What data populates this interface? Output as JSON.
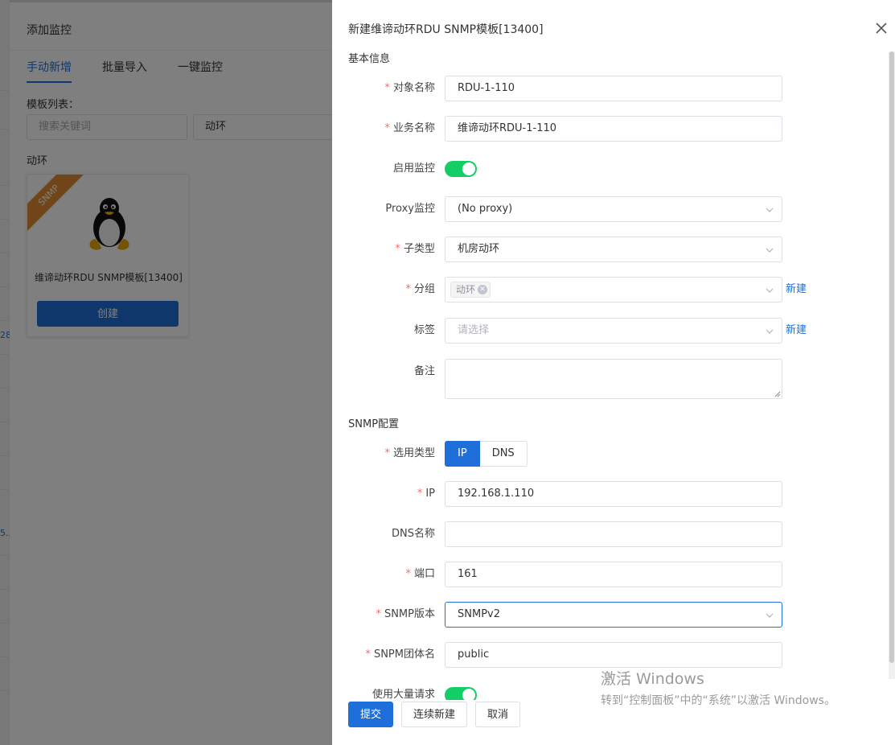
{
  "background": {
    "panel_title": "添加监控",
    "tabs": [
      "手动新增",
      "批量导入",
      "一键监控"
    ],
    "template_list_label": "模板列表：",
    "search_placeholder": "搜索关键词",
    "filter_value": "动环",
    "group_label": "动环",
    "card": {
      "ribbon": "SNMP",
      "name": "维谛动环RDU SNMP模板[13400]",
      "create_button": "创建"
    },
    "left_snippets": [
      "28",
      "5.."
    ]
  },
  "drawer": {
    "title": "新建维谛动环RDU SNMP模板[13400]",
    "basic_section": "基本信息",
    "snmp_section": "SNMP配置",
    "fields": {
      "object_name": {
        "label": "对象名称",
        "value": "RDU-1-110"
      },
      "business_name": {
        "label": "业务名称",
        "value": "维谛动环RDU-1-110"
      },
      "enable_monitor": {
        "label": "启用监控",
        "enabled": true
      },
      "proxy": {
        "label": "Proxy监控",
        "value": "(No proxy)"
      },
      "subtype": {
        "label": "子类型",
        "value": "机房动环"
      },
      "group": {
        "label": "分组",
        "tag": "动环",
        "link": "新建"
      },
      "tags": {
        "label": "标签",
        "placeholder": "请选择",
        "link": "新建"
      },
      "remark": {
        "label": "备注",
        "value": ""
      },
      "select_type": {
        "label": "选用类型",
        "options": [
          "IP",
          "DNS"
        ],
        "selected": "IP"
      },
      "ip": {
        "label": "IP",
        "value": "192.168.1.110"
      },
      "dns_name": {
        "label": "DNS名称",
        "value": ""
      },
      "port": {
        "label": "端口",
        "value": "161"
      },
      "snmp_version": {
        "label": "SNMP版本",
        "value": "SNMPv2"
      },
      "community": {
        "label": "SNPM团体名",
        "value": "public"
      },
      "bulk_request": {
        "label": "使用大量请求",
        "enabled": true
      }
    },
    "buttons": {
      "submit": "提交",
      "continue": "连续新建",
      "cancel": "取消"
    }
  },
  "watermark": {
    "line1": "激活 Windows",
    "line2": "转到“控制面板”中的“系统”以激活 Windows。"
  },
  "colors": {
    "primary": "#1e6fd9",
    "switch_on": "#13ce66",
    "required": "#f56c6c",
    "ribbon": "#e08a2e"
  }
}
